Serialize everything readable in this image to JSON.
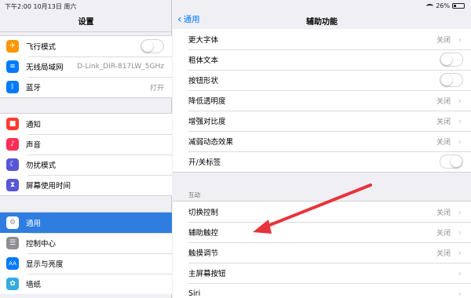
{
  "status_bar": {
    "time_date": "下午2:00  10月13日 周六",
    "battery": "26%"
  },
  "left": {
    "title": "设置",
    "group1": [
      {
        "label": "飞行模式",
        "icon": "airplane-icon",
        "color": "#ff9500",
        "glyph": "✈",
        "value": "",
        "toggle": true
      },
      {
        "label": "无线局域网",
        "icon": "wifi-icon",
        "color": "#007aff",
        "glyph": "≋",
        "value": "D-Link_DIR-817LW_5GHz"
      },
      {
        "label": "蓝牙",
        "icon": "bluetooth-icon",
        "color": "#007aff",
        "glyph": "ᛒ",
        "value": "打开"
      }
    ],
    "group2": [
      {
        "label": "通知",
        "icon": "notifications-icon",
        "color": "#ff3b30",
        "glyph": "■"
      },
      {
        "label": "声音",
        "icon": "sound-icon",
        "color": "#ff2d55",
        "glyph": "♪"
      },
      {
        "label": "勿扰模式",
        "icon": "moon-icon",
        "color": "#5856d6",
        "glyph": "☾"
      },
      {
        "label": "屏幕使用时间",
        "icon": "hourglass-icon",
        "color": "#5856d6",
        "glyph": "⧗"
      }
    ],
    "group3": [
      {
        "label": "通用",
        "icon": "gear-icon",
        "color": "#8e8e93",
        "glyph": "⚙",
        "active": true
      },
      {
        "label": "控制中心",
        "icon": "control-center-icon",
        "color": "#8e8e93",
        "glyph": "☰"
      },
      {
        "label": "显示与亮度",
        "icon": "display-icon",
        "color": "#007aff",
        "glyph": "AA"
      },
      {
        "label": "墙纸",
        "icon": "wallpaper-icon",
        "color": "#34aadc",
        "glyph": "✿"
      }
    ]
  },
  "right": {
    "back_label": "通用",
    "title": "辅助功能",
    "group1": [
      {
        "label": "更大字体",
        "value": "关闭",
        "kind": "chevron"
      },
      {
        "label": "粗体文本",
        "kind": "toggle"
      },
      {
        "label": "按钮形状",
        "kind": "toggle"
      },
      {
        "label": "降低透明度",
        "value": "关闭",
        "kind": "chevron"
      },
      {
        "label": "增强对比度",
        "value": "关闭",
        "kind": "chevron"
      },
      {
        "label": "减弱动态效果",
        "value": "关闭",
        "kind": "chevron"
      },
      {
        "label": "开/关标签",
        "kind": "toggle"
      }
    ],
    "section_header": "互动",
    "group2": [
      {
        "label": "切换控制",
        "value": "关闭",
        "kind": "chevron"
      },
      {
        "label": "辅助触控",
        "value": "关闭",
        "kind": "chevron"
      },
      {
        "label": "触摸调节",
        "value": "关闭",
        "kind": "chevron"
      },
      {
        "label": "主屏幕按钮",
        "kind": "chevron"
      },
      {
        "label": "Siri",
        "kind": "chevron"
      }
    ]
  },
  "annotation": {
    "arrow_color": "#e8333c"
  }
}
